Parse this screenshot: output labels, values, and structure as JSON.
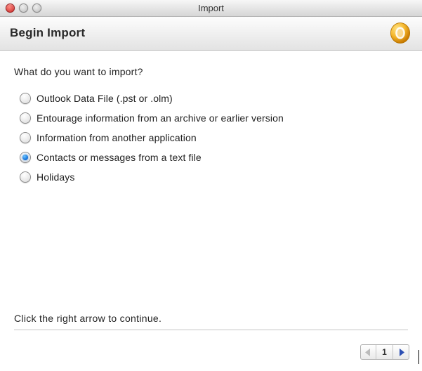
{
  "window": {
    "title": "Import"
  },
  "header": {
    "title": "Begin Import",
    "logo_name": "outlook-logo",
    "logo_color_outer": "#f5b82e",
    "logo_color_inner": "#e08f00"
  },
  "prompt": "What do you want to import?",
  "options": [
    {
      "label": "Outlook Data File (.pst or .olm)",
      "selected": false
    },
    {
      "label": "Entourage information from an archive or earlier version",
      "selected": false
    },
    {
      "label": "Information from another application",
      "selected": false
    },
    {
      "label": "Contacts or messages from a text file",
      "selected": true
    },
    {
      "label": "Holidays",
      "selected": false
    }
  ],
  "footer": {
    "hint": "Click the right arrow to continue."
  },
  "pager": {
    "page": "1",
    "prev_enabled": false,
    "next_enabled": true
  }
}
